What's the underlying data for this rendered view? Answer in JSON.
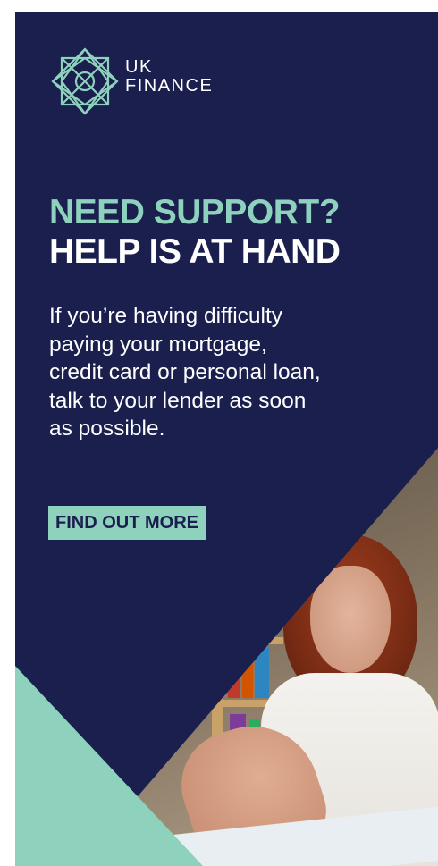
{
  "brand": {
    "line1": "UK",
    "line2": "FINANCE"
  },
  "headline": {
    "line1": "NEED SUPPORT?",
    "line2": "HELP IS AT HAND"
  },
  "body": {
    "lines": [
      "If you’re having difficulty",
      "paying your mortgage,",
      "credit card or personal loan,",
      "talk to your lender as soon",
      "as possible."
    ]
  },
  "cta": {
    "label": "FIND OUT MORE"
  },
  "colors": {
    "navy": "#1a1f4e",
    "mint": "#8ed1bd",
    "white": "#ffffff"
  },
  "icons": {
    "logo": "uk-finance-logo-icon"
  }
}
